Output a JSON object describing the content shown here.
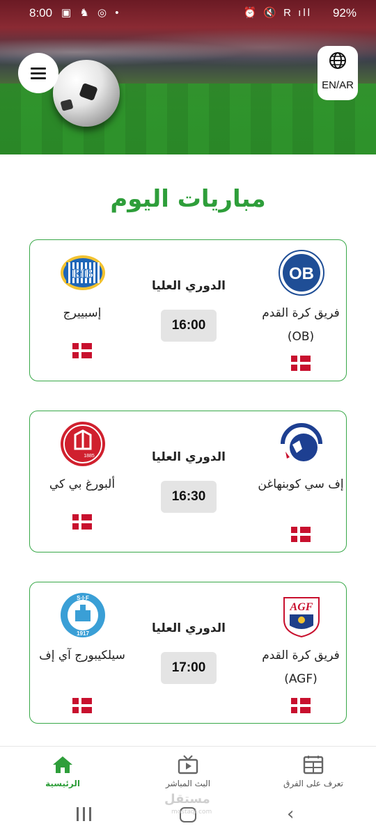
{
  "status_bar": {
    "time": "8:00",
    "battery": "92%",
    "left_icons": "▣ ♞ ◎ •",
    "right_icons": "⏰ 🔇 R ıll"
  },
  "header": {
    "menu_icon": "hamburger-menu-icon",
    "lang_label": "EN/AR"
  },
  "title": "مباريات اليوم",
  "matches": [
    {
      "league": "الدوري العليا",
      "time": "16:00",
      "home_team": "فريق كرة القدم (OB)",
      "away_team": "إسبييرج",
      "home_flag": "denmark-flag",
      "away_flag": "denmark-flag"
    },
    {
      "league": "الدوري العليا",
      "time": "16:30",
      "home_team": "إف سي كوبنهاغن",
      "away_team": "ألبورغ بي كي",
      "home_flag": "denmark-flag",
      "away_flag": "denmark-flag"
    },
    {
      "league": "الدوري العليا",
      "time": "17:00",
      "home_team": "فريق كرة القدم (AGF)",
      "away_team": "سيلكيبورج آي إف",
      "home_flag": "denmark-flag",
      "away_flag": "denmark-flag"
    }
  ],
  "logos": {
    "ob": "OB",
    "esbjerg": "EfB",
    "aab_year": "1885",
    "silkeborg_top": "S·I·F",
    "silkeborg_year": "1917",
    "agf": "AGF"
  },
  "bottom_nav": [
    {
      "label": "الرئيسية",
      "icon": "home-icon",
      "active": true
    },
    {
      "label": "البث المباشر",
      "icon": "tv-icon",
      "active": false
    },
    {
      "label": "تعرف على الفرق",
      "icon": "calendar-icon",
      "active": false
    }
  ],
  "watermark": {
    "main": "مستقل",
    "sub": "mostaql.com"
  },
  "colors": {
    "accent": "#2e9e3a",
    "card_border": "#38a848",
    "flag_red": "#c8102e"
  }
}
